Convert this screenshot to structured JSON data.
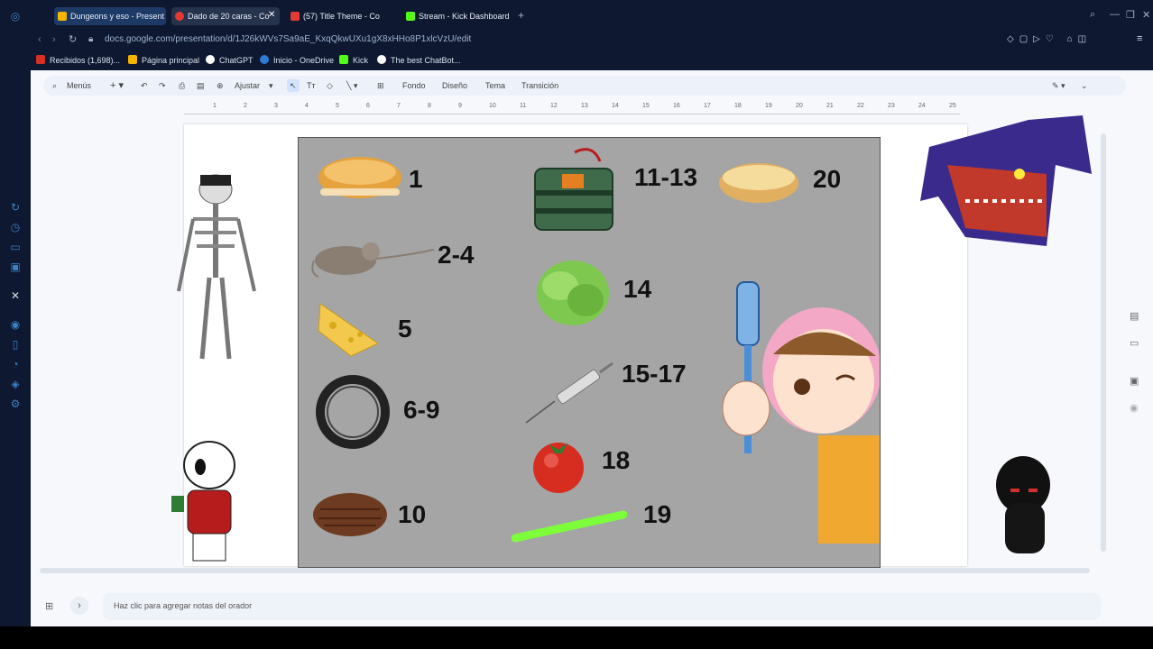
{
  "tabs": [
    {
      "label": "Dungeons y eso - Present",
      "color": "#f4b400",
      "active": false
    },
    {
      "label": "Dado de 20 caras - Co",
      "color": "#e53935",
      "active": true
    },
    {
      "label": "(57) Title Theme - Co",
      "color": "#e53935",
      "active": false
    },
    {
      "label": "Stream - Kick Dashboard",
      "color": "#53fc18",
      "active": false
    }
  ],
  "address": {
    "url": "docs.google.com/presentation/d/1J26kWVs7Sa9aE_KxqQkwUXu1gX8xHHo8P1xlcVzU/edit"
  },
  "bookmarks": [
    {
      "label": "Recibidos (1,698)...",
      "color": "#d93025"
    },
    {
      "label": "Página principal",
      "color": "#f4b400"
    },
    {
      "label": "ChatGPT",
      "color": "#ffffff"
    },
    {
      "label": "Inicio - OneDrive",
      "color": "#2b7cd3"
    },
    {
      "label": "Kick",
      "color": "#53fc18"
    },
    {
      "label": "The best ChatBot...",
      "color": "#ffffff"
    }
  ],
  "toolbar": {
    "search_label": "Menús",
    "zoom_label": "Ajustar",
    "background_label": "Fondo",
    "layout_label": "Diseño",
    "theme_label": "Tema",
    "transition_label": "Transición"
  },
  "ruler": [
    "1",
    "2",
    "3",
    "4",
    "5",
    "6",
    "7",
    "8",
    "9",
    "10",
    "11",
    "12",
    "13",
    "14",
    "15",
    "16",
    "17",
    "18",
    "19",
    "20",
    "21",
    "22",
    "23",
    "24",
    "25"
  ],
  "slide": {
    "items": [
      {
        "label": "1",
        "icon": "bun-top-icon"
      },
      {
        "label": "2-4",
        "icon": "rat-icon"
      },
      {
        "label": "5",
        "icon": "cheese-icon"
      },
      {
        "label": "6-9",
        "icon": "tire-icon"
      },
      {
        "label": "10",
        "icon": "patty-icon"
      },
      {
        "label": "11-13",
        "icon": "c4-bomb-icon"
      },
      {
        "label": "14",
        "icon": "lettuce-icon"
      },
      {
        "label": "15-17",
        "icon": "syringe-icon"
      },
      {
        "label": "18",
        "icon": "tomato-icon"
      },
      {
        "label": "19",
        "icon": "glowstick-icon"
      },
      {
        "label": "20",
        "icon": "bun-bottom-icon"
      }
    ]
  },
  "notes": {
    "placeholder": "Haz clic para agregar notas del orador"
  }
}
